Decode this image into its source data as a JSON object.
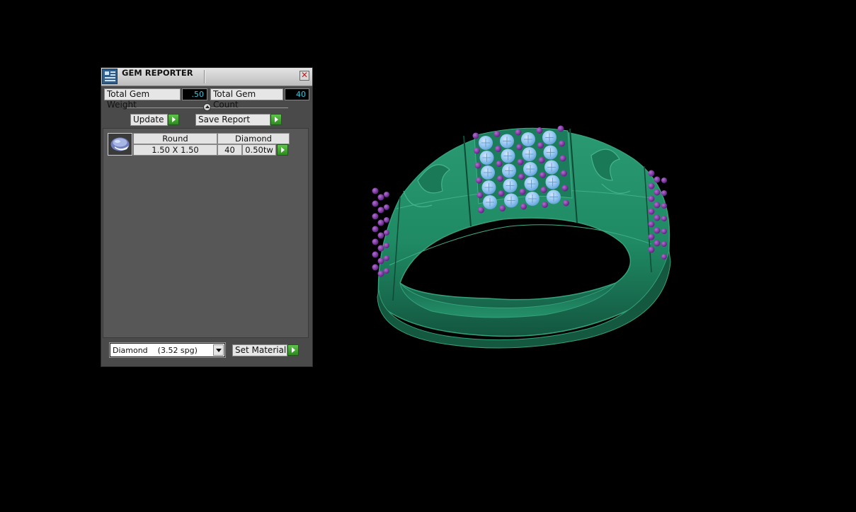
{
  "window": {
    "title": "GEM REPORTER",
    "close_symbol": "✕"
  },
  "stats": {
    "weight_label": "Total Gem Weight",
    "weight_value": ".50",
    "count_label": "Total Gem Count",
    "count_value": "40"
  },
  "buttons": {
    "update_label": "Update",
    "save_report_label": "Save Report",
    "set_material_label": "Set Material"
  },
  "gem_table": {
    "rows": [
      {
        "icon": "round-gem-icon",
        "shape": "Round",
        "material": "Diamond",
        "size": "1.50 X 1.50",
        "count": "40",
        "weight": "0.50tw"
      }
    ]
  },
  "material_select": {
    "selected": "Diamond    (3.52 spg)"
  },
  "viewport": {
    "model": "ring-model",
    "colors": {
      "background": "#000000",
      "metal": "#1f8a64",
      "metal_dark": "#145e45",
      "metal_edge": "#35a07a",
      "diamond": "#8ec3ef",
      "prong": "#7a2aa0"
    }
  }
}
